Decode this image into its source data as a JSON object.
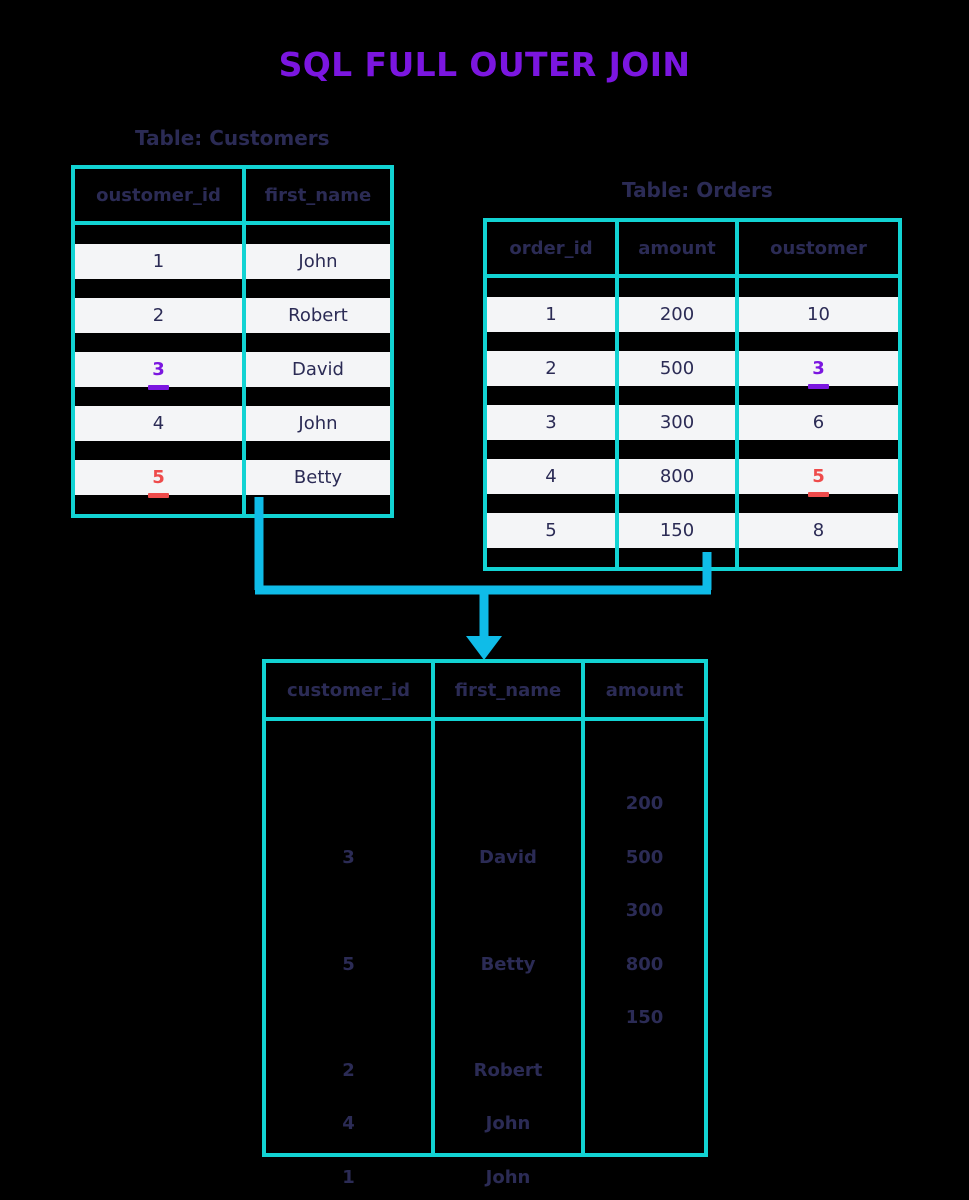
{
  "title": "SQL FULL OUTER JOIN",
  "colors": {
    "title_purple": "#7B16E0",
    "table_border_teal": "#12D3D3",
    "connector_blue": "#0FBCE8",
    "text_navy": "#2B2B55",
    "row_bg": "#F4F5F7",
    "highlight_purple": "#7B16E0",
    "highlight_red": "#EE4B4B",
    "background": "#000000"
  },
  "customers": {
    "caption": "Table: Customers",
    "columns": [
      "oustomer_id",
      "first_name"
    ],
    "rows": [
      {
        "customer_id": "1",
        "first_name": "John",
        "highlight": ""
      },
      {
        "customer_id": "2",
        "first_name": "Robert",
        "highlight": ""
      },
      {
        "customer_id": "3",
        "first_name": "David",
        "highlight": "purple"
      },
      {
        "customer_id": "4",
        "first_name": "John",
        "highlight": ""
      },
      {
        "customer_id": "5",
        "first_name": "Betty",
        "highlight": "red"
      }
    ]
  },
  "orders": {
    "caption": "Table: Orders",
    "columns": [
      "order_id",
      "amount",
      "oustomer"
    ],
    "rows": [
      {
        "order_id": "1",
        "amount": "200",
        "customer": "10",
        "highlight": ""
      },
      {
        "order_id": "2",
        "amount": "500",
        "customer": "3",
        "highlight": "purple"
      },
      {
        "order_id": "3",
        "amount": "300",
        "customer": "6",
        "highlight": ""
      },
      {
        "order_id": "4",
        "amount": "800",
        "customer": "5",
        "highlight": "red"
      },
      {
        "order_id": "5",
        "amount": "150",
        "customer": "8",
        "highlight": ""
      }
    ]
  },
  "result": {
    "columns": [
      "customer_id",
      "first_name",
      "amount"
    ],
    "customer_id_values": [
      "3",
      "5",
      "2",
      "4",
      "1"
    ],
    "first_name_values": [
      "David",
      "Betty",
      "Robert",
      "John",
      "John"
    ],
    "amount_values": [
      "200",
      "500",
      "300",
      "800",
      "150"
    ]
  }
}
